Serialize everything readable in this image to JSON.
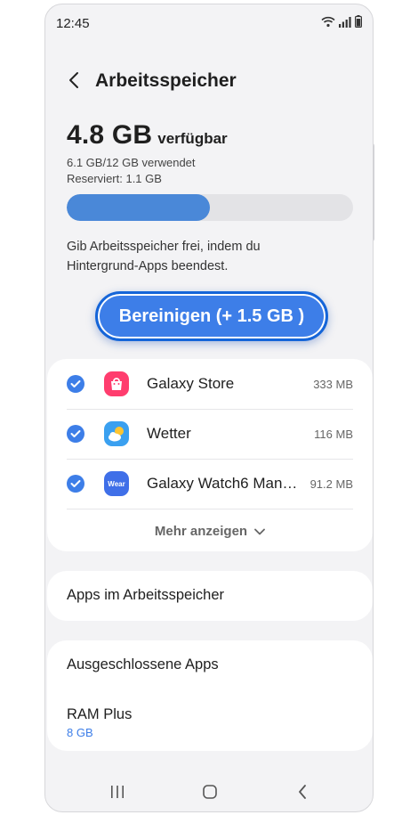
{
  "status_bar": {
    "time": "12:45",
    "icons": [
      "wifi-icon",
      "signal-icon",
      "battery-icon"
    ]
  },
  "header": {
    "title": "Arbeitsspeicher",
    "back_icon": "chevron-left-icon"
  },
  "memory": {
    "available_value": "4.8 GB",
    "available_label": "verfügbar",
    "used_text": "6.1 GB/12 GB verwendet",
    "reserved_text": "Reserviert: 1.1 GB",
    "used_fraction": 0.5,
    "hint_line1": "Gib Arbeitsspeicher frei, indem du",
    "hint_line2": "Hintergrund-Apps beendest."
  },
  "clean_button": {
    "label": "Bereinigen (+ 1.5 GB )"
  },
  "apps": [
    {
      "name": "Galaxy Store",
      "size": "333 MB",
      "icon": "galaxy-store-icon",
      "checked": true
    },
    {
      "name": "Wetter",
      "size": "116 MB",
      "icon": "weather-icon",
      "checked": true
    },
    {
      "name": "Galaxy Watch6 Man…",
      "size": "91.2 MB",
      "icon": "wear-icon",
      "checked": true
    }
  ],
  "wear_icon_text": "Wear",
  "more": {
    "label": "Mehr anzeigen"
  },
  "menu": {
    "apps_in_memory": "Apps im Arbeitsspeicher",
    "excluded_apps": "Ausgeschlossene Apps",
    "ram_plus_label": "RAM Plus",
    "ram_plus_value": "8 GB"
  },
  "nav": {
    "icons": [
      "recents-icon",
      "home-icon",
      "back-icon"
    ]
  },
  "colors": {
    "accent": "#3d7ee8",
    "progress": "#4a88d8",
    "background": "#f3f3f5",
    "card": "#ffffff"
  }
}
